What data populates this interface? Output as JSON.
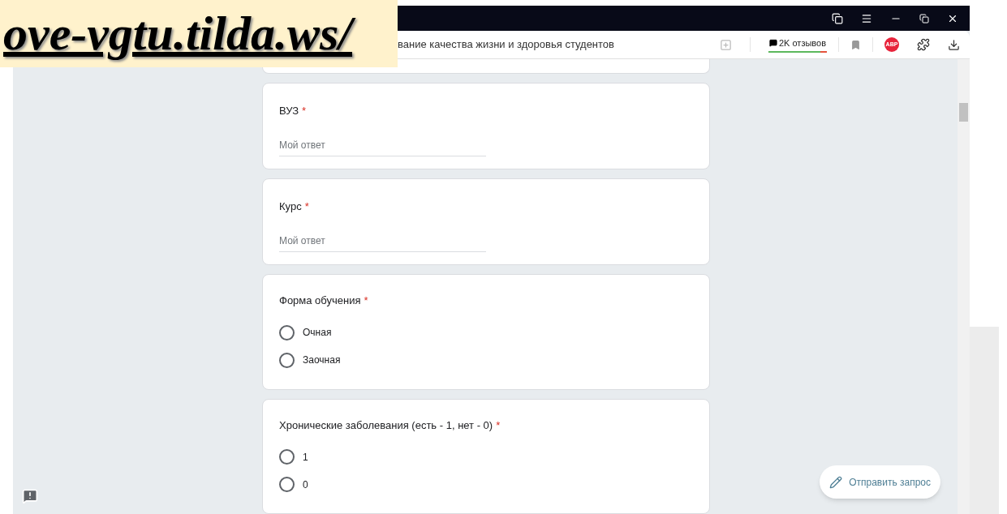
{
  "overlay_label": {
    "text": "ove-vgtu.tilda.ws/"
  },
  "browser": {
    "tab_title": "вание качества жизни и здоровья студентов",
    "reviews_badge": "2K отзывов",
    "adblock_badge": "ABP"
  },
  "questions": [
    {
      "kind": "partial"
    },
    {
      "kind": "text",
      "title": "ВУЗ",
      "required_mark": "*",
      "placeholder": "Мой ответ"
    },
    {
      "kind": "text",
      "title": "Курс",
      "required_mark": "*",
      "placeholder": "Мой ответ"
    },
    {
      "kind": "radio",
      "title": "Форма обучения",
      "required_mark": "*",
      "options": [
        {
          "label": "Очная",
          "selected": false
        },
        {
          "label": "Заочная",
          "selected": false
        }
      ]
    },
    {
      "kind": "radio",
      "title": "Хронические заболевания (есть - 1, нет - 0)",
      "required_mark": "*",
      "options": [
        {
          "label": "1",
          "selected": false
        },
        {
          "label": "0",
          "selected": false
        }
      ]
    }
  ],
  "submit_request_button": "Отправить запрос"
}
